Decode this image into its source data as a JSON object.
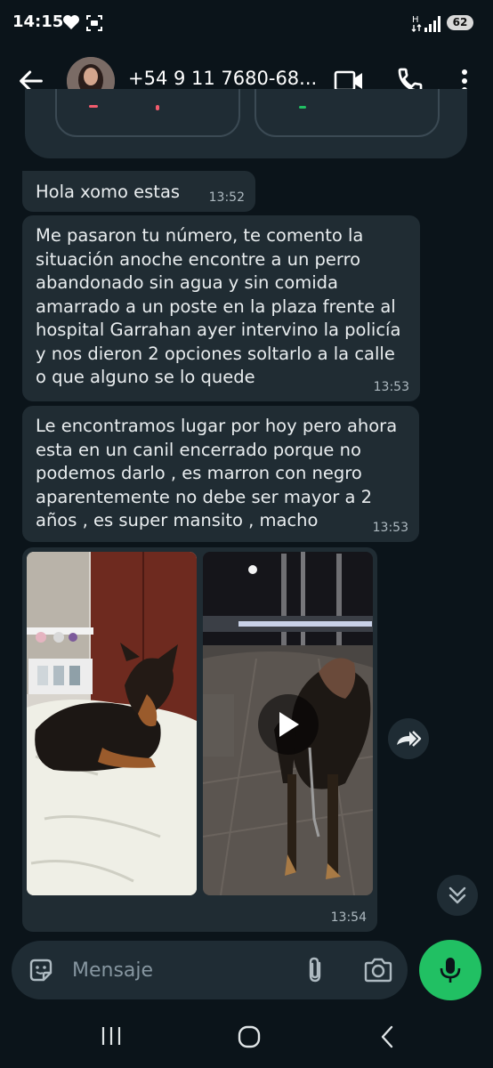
{
  "status_bar": {
    "time": "14:15",
    "battery": "62",
    "network": "H"
  },
  "header": {
    "contact": "+54 9 11 7680-68..."
  },
  "messages": [
    {
      "text": "Hola xomo estas",
      "time": "13:52"
    },
    {
      "text": "Me pasaron tu número,  te comento la situación anoche encontre a un perro abandonado sin agua y sin comida amarrado a un poste en la plaza frente al hospital Garrahan ayer intervino la policía y nos dieron 2 opciones soltarlo a la calle o que alguno se lo quede",
      "time": "13:53"
    },
    {
      "text": "Le encontramos lugar por hoy pero ahora esta en un canil encerrado porque no podemos darlo , es marron con negro aparentemente no debe ser mayor a 2 años , es super mansito , macho",
      "time": "13:53"
    }
  ],
  "media_message": {
    "time": "13:54"
  },
  "composer": {
    "placeholder": "Mensaje"
  },
  "colors": {
    "background": "#0b141a",
    "bubble": "#202c33",
    "accent": "#21c063"
  }
}
